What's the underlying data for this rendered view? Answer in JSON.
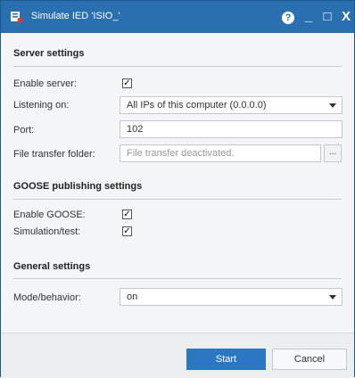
{
  "window": {
    "title": "Simulate IED 'ISIO_'",
    "help_label": "?",
    "minimize_label": "_",
    "maximize_label": "□",
    "close_label": "X"
  },
  "server_settings": {
    "header": "Server settings",
    "enable_server_label": "Enable server:",
    "enable_server_checked": "✓",
    "listening_on_label": "Listening on:",
    "listening_on_value": "All IPs of this computer (0.0.0.0)",
    "port_label": "Port:",
    "port_value": "102",
    "file_transfer_label": "File transfer folder:",
    "file_transfer_placeholder": "File transfer deactivated.",
    "browse_label": "..."
  },
  "goose_settings": {
    "header": "GOOSE publishing settings",
    "enable_goose_label": "Enable GOOSE:",
    "enable_goose_checked": "✓",
    "simulation_label": "Simulation/test:",
    "simulation_checked": "✓"
  },
  "general_settings": {
    "header": "General settings",
    "mode_label": "Mode/behavior:",
    "mode_value": "on"
  },
  "footer": {
    "start_label": "Start",
    "cancel_label": "Cancel"
  },
  "colors": {
    "titlebar": "#2a6fb0",
    "primary_button": "#2c77c1"
  },
  "icons": {
    "app": "simulate-ied-icon",
    "help": "help-icon",
    "minimize": "minimize-icon",
    "maximize": "maximize-icon",
    "close": "close-icon",
    "dropdown": "chevron-down-icon"
  }
}
